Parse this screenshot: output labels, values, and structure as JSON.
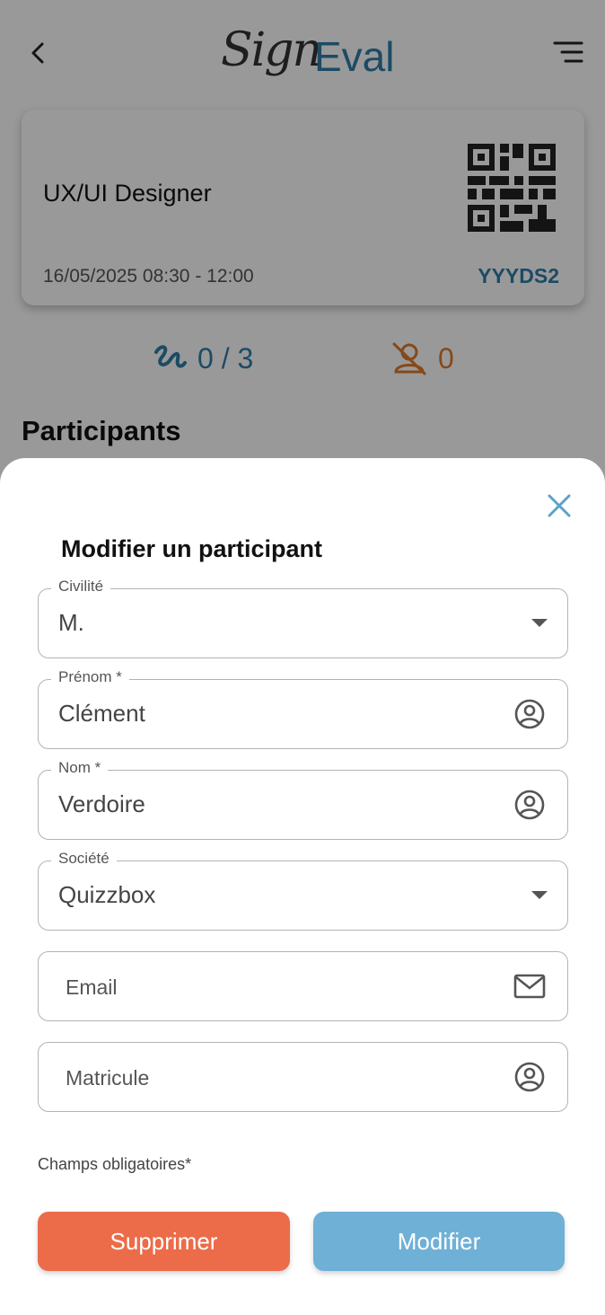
{
  "header": {
    "logo_script": "Sign",
    "logo_brand": "Eval"
  },
  "session": {
    "title": "UX/UI Designer",
    "datetime": "16/05/2025 08:30 - 12:00",
    "code": "YYYDS2"
  },
  "stats": {
    "signed": "0 / 3",
    "absent": "0"
  },
  "participants_heading": "Participants",
  "modal": {
    "title": "Modifier un participant",
    "fields": {
      "civilite": {
        "label": "Civilité",
        "value": "M."
      },
      "prenom": {
        "label": "Prénom *",
        "value": "Clément"
      },
      "nom": {
        "label": "Nom *",
        "value": "Verdoire"
      },
      "societe": {
        "label": "Société",
        "value": "Quizzbox"
      },
      "email": {
        "placeholder": "Email"
      },
      "matricule": {
        "placeholder": "Matricule"
      }
    },
    "required_note": "Champs obligatoires*",
    "delete_label": "Supprimer",
    "edit_label": "Modifier"
  },
  "colors": {
    "brand_blue": "#2f7ea8",
    "absent_orange": "#e07b2b",
    "delete_button": "#ec6c49",
    "edit_button": "#6fb0d6",
    "close_icon": "#5aa3c9"
  }
}
